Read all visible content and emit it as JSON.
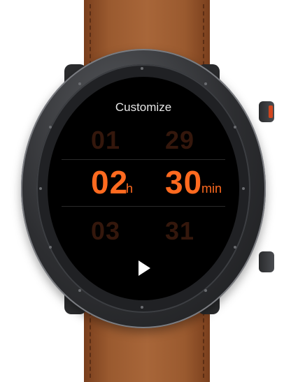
{
  "screen": {
    "title": "Customize",
    "hours": {
      "prev": "01",
      "current": "02",
      "next": "03",
      "unit": "h"
    },
    "minutes": {
      "prev": "29",
      "current": "30",
      "next": "31",
      "unit": "min"
    },
    "start_icon": "play-icon"
  },
  "colors": {
    "accent": "#ff6a1f",
    "strap": "#9a5a2f"
  }
}
